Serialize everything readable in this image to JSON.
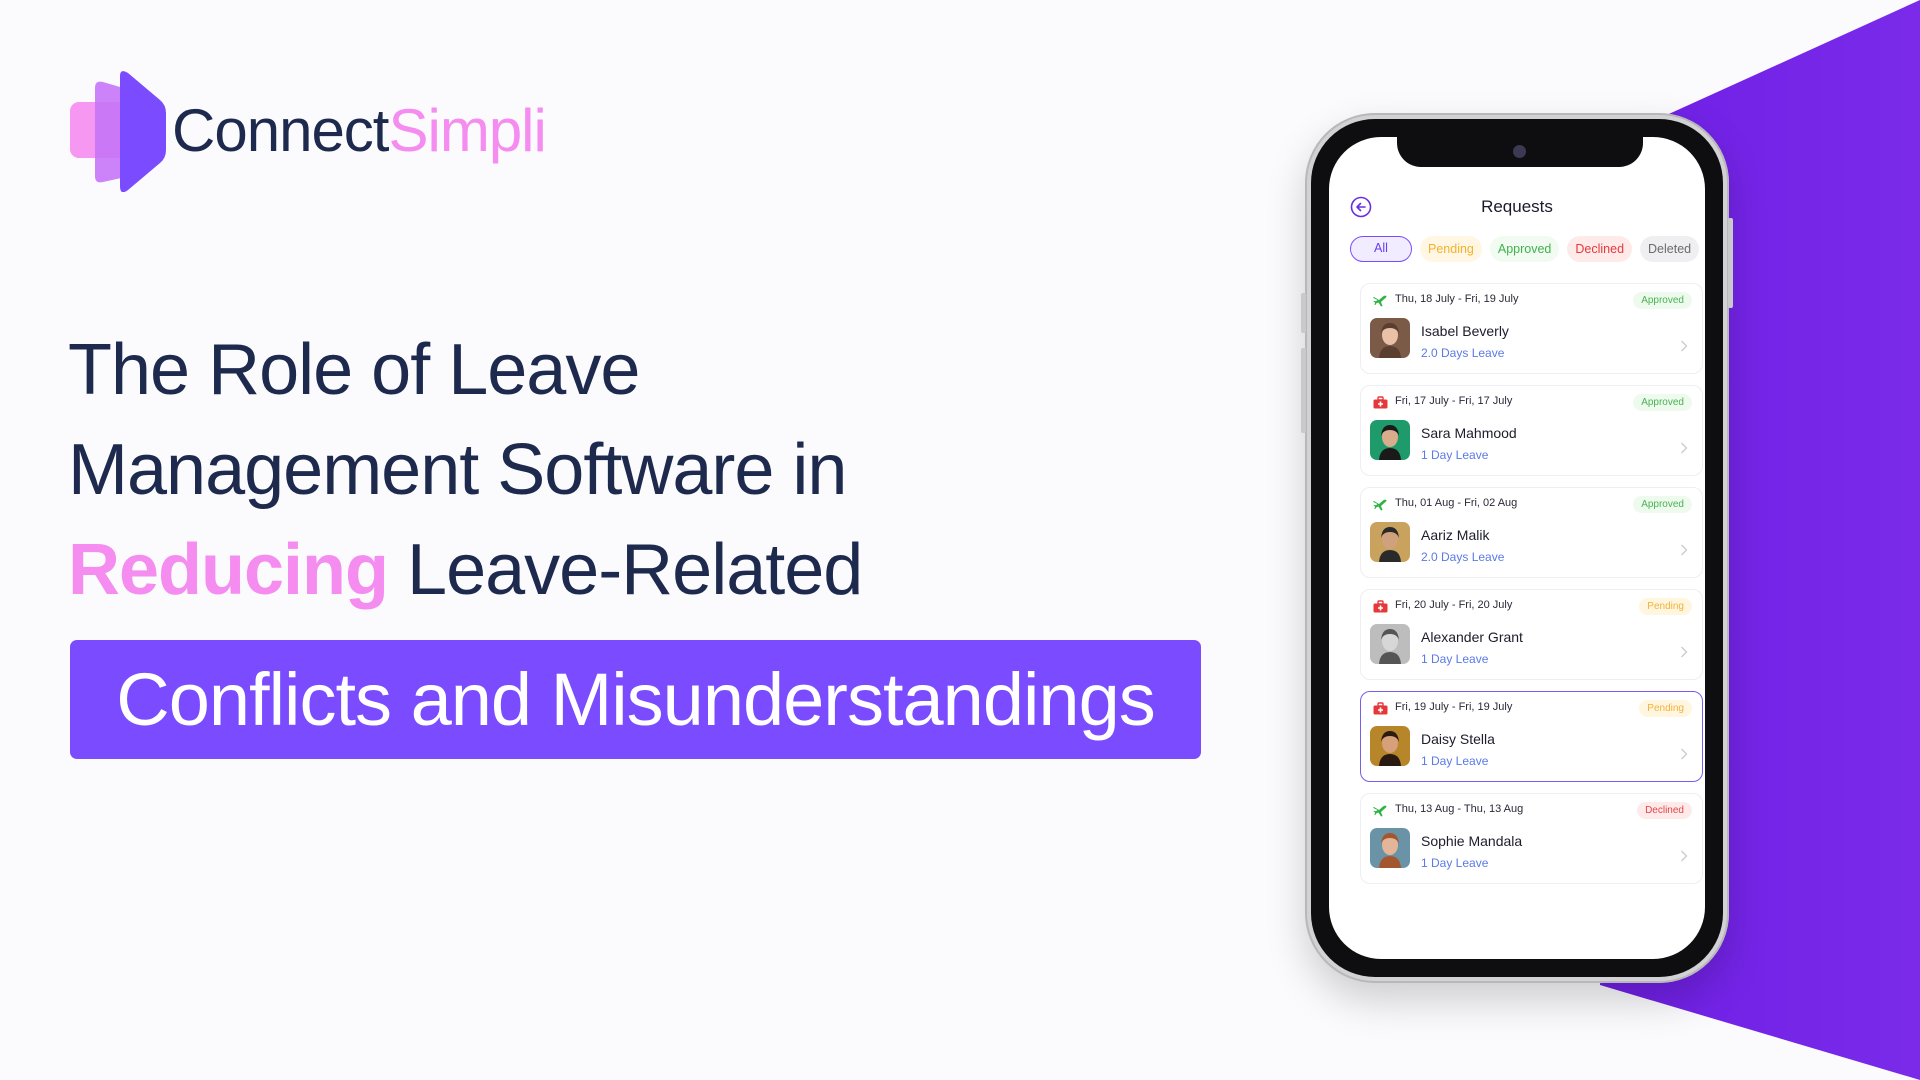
{
  "colors": {
    "brand_purple": "#7a4bff",
    "brand_pink": "#f58cf0",
    "navy_text": "#1d2a4d",
    "bg_purple": "#7320e8"
  },
  "logo": {
    "word1": "Connect",
    "word2": "Simpli",
    "icon": "layered-hexagon-logo-icon"
  },
  "headline": {
    "line1": "The Role of Leave",
    "line2": "Management Software in",
    "line3_highlight": "Reducing",
    "line3_rest": " Leave-Related",
    "banner": "Conflicts and Misunderstandings"
  },
  "phone": {
    "header": {
      "back_icon": "back-arrow-circle-icon",
      "title": "Requests"
    },
    "tabs": [
      {
        "label": "All",
        "style": "all",
        "active": true
      },
      {
        "label": "Pending",
        "style": "pending"
      },
      {
        "label": "Approved",
        "style": "approved"
      },
      {
        "label": "Declined",
        "style": "declined"
      },
      {
        "label": "Deleted",
        "style": "deleted"
      }
    ],
    "requests": [
      {
        "type_icon": "airplane-icon",
        "dates": "Thu, 18 July - Fri, 19 July",
        "status": "Approved",
        "status_style": "approved",
        "name": "Isabel Beverly",
        "leave": "2.0 Days Leave",
        "selected": false
      },
      {
        "type_icon": "medical-kit-icon",
        "dates": "Fri, 17 July - Fri, 17 July",
        "status": "Approved",
        "status_style": "approved",
        "name": "Sara Mahmood",
        "leave": "1 Day Leave",
        "selected": false
      },
      {
        "type_icon": "airplane-icon",
        "dates": "Thu, 01 Aug - Fri, 02 Aug",
        "status": "Approved",
        "status_style": "approved",
        "name": "Aariz Malik",
        "leave": "2.0 Days Leave",
        "selected": false
      },
      {
        "type_icon": "medical-kit-icon",
        "dates": "Fri, 20 July - Fri, 20 July",
        "status": "Pending",
        "status_style": "pending",
        "name": "Alexander Grant",
        "leave": "1 Day Leave",
        "selected": false
      },
      {
        "type_icon": "medical-kit-icon",
        "dates": "Fri, 19 July - Fri, 19 July",
        "status": "Pending",
        "status_style": "pending",
        "name": "Daisy Stella",
        "leave": "1 Day Leave",
        "selected": true
      },
      {
        "type_icon": "airplane-icon",
        "dates": "Thu, 13 Aug - Thu, 13 Aug",
        "status": "Declined",
        "status_style": "declined",
        "name": "Sophie Mandala",
        "leave": "1 Day Leave",
        "selected": false
      }
    ]
  }
}
